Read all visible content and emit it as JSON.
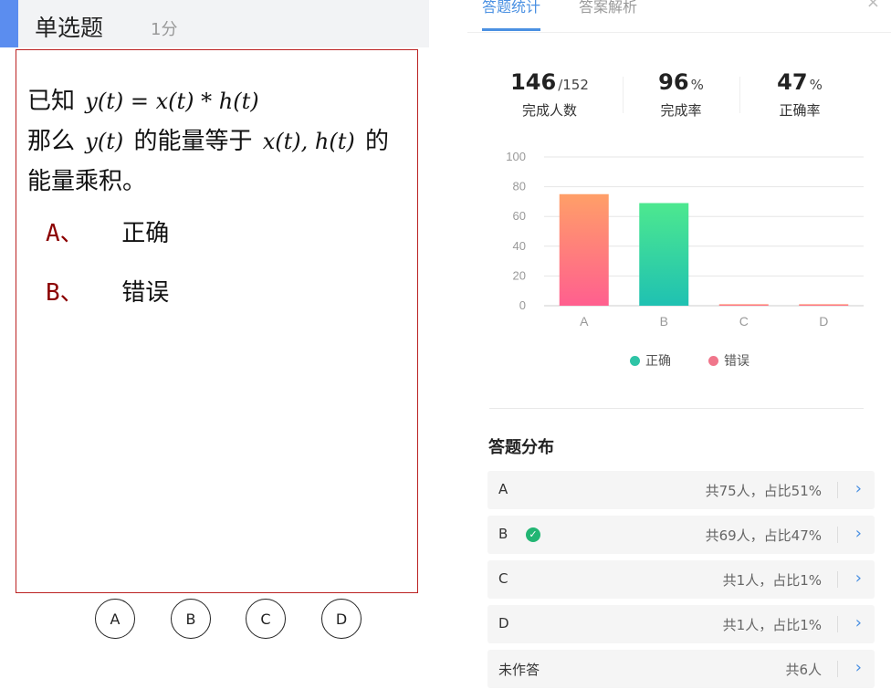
{
  "question": {
    "type_label": "单选题",
    "score_label": "1分",
    "stem_prefix": "已知",
    "stem_math1": "y(t) = x(t) * h(t)",
    "stem_line2_a": "那么",
    "stem_math2": "y(t)",
    "stem_line2_b": "的能量等于",
    "stem_math3": "x(t), h(t)",
    "stem_line2_c": "的",
    "stem_line3": "能量乘积。",
    "options": [
      {
        "letter": "A、",
        "text": "正确"
      },
      {
        "letter": "B、",
        "text": "错误"
      }
    ],
    "choice_circles": [
      "A",
      "B",
      "C",
      "D"
    ]
  },
  "tabs": {
    "stats": "答题统计",
    "analysis": "答案解析",
    "close": "×"
  },
  "summary": {
    "completed": "146",
    "total": "/152",
    "completed_label": "完成人数",
    "completion_rate": "96",
    "completion_unit": "%",
    "completion_label": "完成率",
    "accuracy": "47",
    "accuracy_unit": "%",
    "accuracy_label": "正确率"
  },
  "chart_data": {
    "type": "bar",
    "categories": [
      "A",
      "B",
      "C",
      "D"
    ],
    "series": [
      {
        "name": "正确",
        "values": [
          0,
          69,
          0,
          0
        ]
      },
      {
        "name": "错误",
        "values": [
          75,
          0,
          1,
          1
        ]
      }
    ],
    "ylim": [
      0,
      100
    ],
    "yticks": [
      0,
      20,
      40,
      60,
      80,
      100
    ],
    "grid": true,
    "legend_position": "bottom",
    "colors": {
      "correct": "#2ec4a6",
      "wrong": "#f0768b"
    }
  },
  "legend": {
    "correct": "正确",
    "wrong": "错误"
  },
  "distribution": {
    "title": "答题分布",
    "rows": [
      {
        "label": "A",
        "value": "共75人，占比51%"
      },
      {
        "label": "B",
        "value": "共69人，占比47%"
      },
      {
        "label": "C",
        "value": "共1人，占比1%"
      },
      {
        "label": "D",
        "value": "共1人，占比1%"
      },
      {
        "label": "未作答",
        "value": "共6人"
      }
    ]
  },
  "colors": {
    "accent_blue": "#4a90e2",
    "border_red": "#b22222",
    "check_green": "#22b573"
  }
}
